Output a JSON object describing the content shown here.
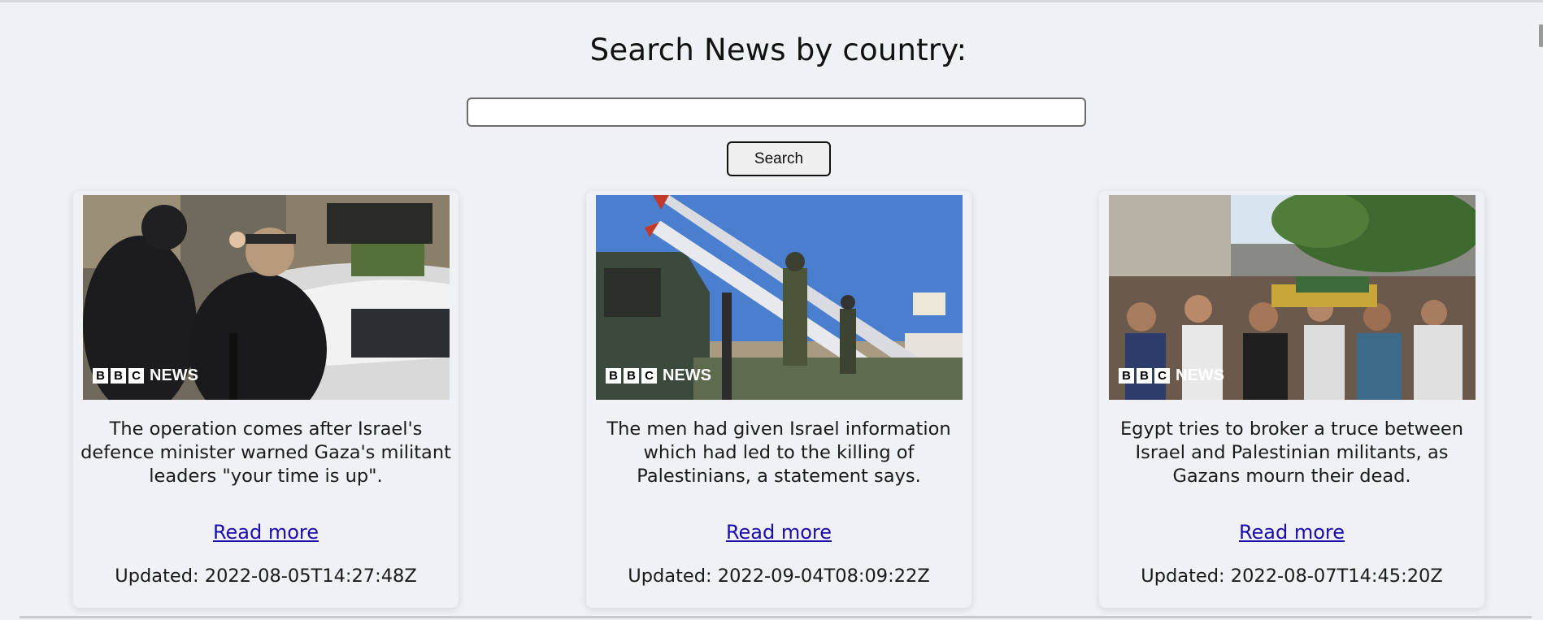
{
  "page": {
    "heading": "Search News by country:",
    "search": {
      "value": "",
      "placeholder": ""
    },
    "search_button_label": "Search"
  },
  "articles": [
    {
      "image_logo": {
        "letters": [
          "B",
          "B",
          "C"
        ],
        "wordmark": "NEWS"
      },
      "description": "The operation comes after Israel's defence minister warned Gaza's militant leaders \"your time is up\".",
      "read_more_label": "Read more",
      "updated_label": "Updated:",
      "updated_value": "2022-08-05T14:27:48Z"
    },
    {
      "image_logo": {
        "letters": [
          "B",
          "B",
          "C"
        ],
        "wordmark": "NEWS"
      },
      "description": "The men had given Israel information which had led to the killing of Palestinians, a statement says.",
      "read_more_label": "Read more",
      "updated_label": "Updated:",
      "updated_value": "2022-09-04T08:09:22Z"
    },
    {
      "image_logo": {
        "letters": [
          "B",
          "B",
          "C"
        ],
        "wordmark": "NEWS"
      },
      "description": "Egypt tries to broker a truce between Israel and Palestinian militants, as Gazans mourn their dead.",
      "read_more_label": "Read more",
      "updated_label": "Updated:",
      "updated_value": "2022-08-07T14:45:20Z"
    }
  ],
  "colors": {
    "background": "#f0f1f5",
    "link": "#1a0dab",
    "text": "#1a1a1a"
  }
}
